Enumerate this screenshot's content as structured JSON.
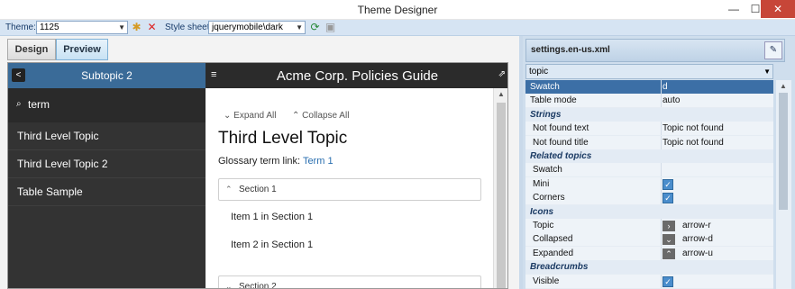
{
  "window": {
    "title": "Theme Designer",
    "minimize": "—",
    "maximize": "☐",
    "close": "✕"
  },
  "toolbar": {
    "theme_label": "Theme:",
    "theme_value": "1125",
    "stylesheet_label": "Style sheet:",
    "stylesheet_value": "jquerymobile\\dark",
    "add_icon": "✱",
    "delete_icon": "✕"
  },
  "tabs": {
    "design": "Design",
    "preview": "Preview"
  },
  "preview": {
    "left_header": "Subtopic 2",
    "back_icon": "<",
    "search_icon": "⌕",
    "search_value": "term",
    "nav_items": [
      "Third Level Topic",
      "Third Level Topic 2",
      "Table Sample"
    ],
    "right_header": "Acme Corp. Policies Guide",
    "menu_icon": "≡",
    "external_icon": "⇗",
    "expand_all": "Expand All",
    "collapse_all": "Collapse All",
    "page_title": "Third Level Topic",
    "glossary_label": "Glossary term link:",
    "glossary_link": "Term 1",
    "sections": [
      {
        "title": "Section 1",
        "items": [
          "Item 1 in Section 1",
          "Item 2 in Section 1"
        ]
      },
      {
        "title": "Section 2",
        "items": []
      }
    ]
  },
  "properties": {
    "file": "settings.en-us.xml",
    "pin_icon": "✎",
    "selector": "topic",
    "rows": [
      {
        "type": "prop",
        "key": "Swatch",
        "value": "d",
        "selected": true
      },
      {
        "type": "prop",
        "key": "Table mode",
        "value": "auto"
      },
      {
        "type": "cat",
        "key": "Strings"
      },
      {
        "type": "prop",
        "key": "Not found text",
        "value": "Topic not found",
        "indent": true
      },
      {
        "type": "prop",
        "key": "Not found title",
        "value": "Topic not found",
        "indent": true
      },
      {
        "type": "cat",
        "key": "Related topics"
      },
      {
        "type": "prop",
        "key": "Swatch",
        "value": "",
        "indent": true
      },
      {
        "type": "check",
        "key": "Mini",
        "indent": true
      },
      {
        "type": "check",
        "key": "Corners",
        "indent": true
      },
      {
        "type": "cat",
        "key": "Icons"
      },
      {
        "type": "icon",
        "key": "Topic",
        "value": "arrow-r",
        "glyph": "›",
        "indent": true
      },
      {
        "type": "icon",
        "key": "Collapsed",
        "value": "arrow-d",
        "glyph": "⌄",
        "indent": true
      },
      {
        "type": "icon",
        "key": "Expanded",
        "value": "arrow-u",
        "glyph": "⌃",
        "indent": true
      },
      {
        "type": "cat",
        "key": "Breadcrumbs"
      },
      {
        "type": "check",
        "key": "Visible",
        "indent": true
      }
    ]
  },
  "colors": {
    "selected_row": "#3c6fa6",
    "left_header": "#3a6b98",
    "link": "#2a6fb0"
  }
}
